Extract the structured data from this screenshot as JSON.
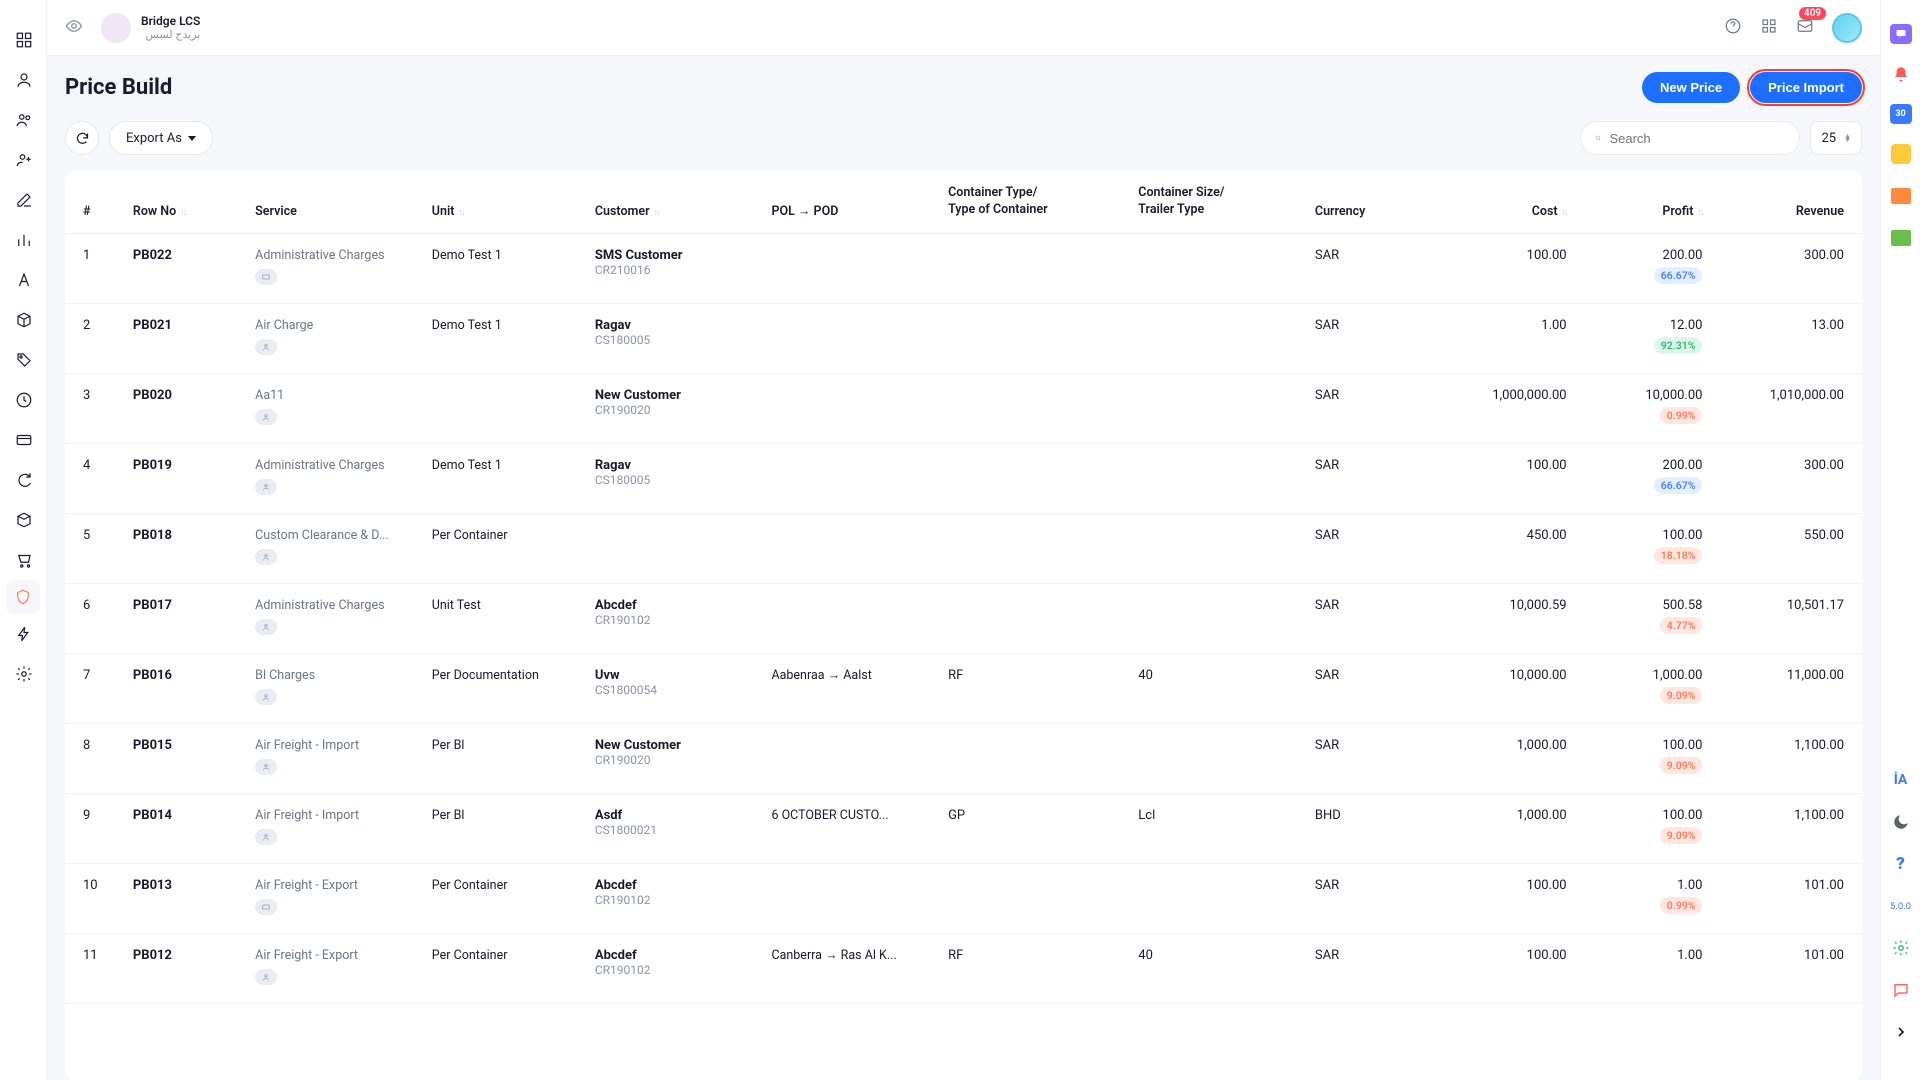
{
  "brand": {
    "name": "Bridge LCS",
    "subtitle": "بريدج لسس"
  },
  "notification_count": "409",
  "page_title": "Price Build",
  "actions": {
    "new_price": "New Price",
    "price_import": "Price Import"
  },
  "toolbar": {
    "export": "Export As",
    "search_placeholder": "Search",
    "page_size": "25"
  },
  "columns": {
    "idx": "#",
    "row_no": "Row No",
    "service": "Service",
    "unit": "Unit",
    "customer": "Customer",
    "pol_pod": "POL → POD",
    "container_type_l1": "Container Type/",
    "container_type_l2": "Type of Container",
    "container_size_l1": "Container Size/",
    "container_size_l2": "Trailer Type",
    "currency": "Currency",
    "cost": "Cost",
    "profit": "Profit",
    "revenue": "Revenue"
  },
  "rail": {
    "cal": "30",
    "lang": "İA",
    "question": "?",
    "version": "5.0.0"
  },
  "rows": [
    {
      "i": "1",
      "row": "PB022",
      "svc": "Administrative Charges",
      "ic": "m",
      "unit": "Demo Test 1",
      "cust": "SMS Customer",
      "code": "CR210016",
      "route": "",
      "ctype": "",
      "csize": "",
      "cur": "SAR",
      "cost": "100.00",
      "profit": "200.00",
      "pct": "66.67%",
      "pcls": "blue",
      "rev": "300.00"
    },
    {
      "i": "2",
      "row": "PB021",
      "svc": "Air Charge",
      "ic": "u",
      "unit": "Demo Test 1",
      "cust": "Ragav",
      "code": "CS180005",
      "route": "",
      "ctype": "",
      "csize": "",
      "cur": "SAR",
      "cost": "1.00",
      "profit": "12.00",
      "pct": "92.31%",
      "pcls": "green",
      "rev": "13.00"
    },
    {
      "i": "3",
      "row": "PB020",
      "svc": "Aa11",
      "ic": "u",
      "unit": "",
      "cust": "New Customer",
      "code": "CR190020",
      "route": "",
      "ctype": "",
      "csize": "",
      "cur": "SAR",
      "cost": "1,000,000.00",
      "profit": "10,000.00",
      "pct": "0.99%",
      "pcls": "red",
      "rev": "1,010,000.00"
    },
    {
      "i": "4",
      "row": "PB019",
      "svc": "Administrative Charges",
      "ic": "u",
      "unit": "Demo Test 1",
      "cust": "Ragav",
      "code": "CS180005",
      "route": "",
      "ctype": "",
      "csize": "",
      "cur": "SAR",
      "cost": "100.00",
      "profit": "200.00",
      "pct": "66.67%",
      "pcls": "blue",
      "rev": "300.00"
    },
    {
      "i": "5",
      "row": "PB018",
      "svc": "Custom Clearance & D...",
      "ic": "u",
      "unit": "Per Container",
      "cust": "",
      "code": "",
      "route": "",
      "ctype": "",
      "csize": "",
      "cur": "SAR",
      "cost": "450.00",
      "profit": "100.00",
      "pct": "18.18%",
      "pcls": "red",
      "rev": "550.00"
    },
    {
      "i": "6",
      "row": "PB017",
      "svc": "Administrative Charges",
      "ic": "u",
      "unit": "Unit Test",
      "cust": "Abcdef",
      "code": "CR190102",
      "route": "",
      "ctype": "",
      "csize": "",
      "cur": "SAR",
      "cost": "10,000.59",
      "profit": "500.58",
      "pct": "4.77%",
      "pcls": "red",
      "rev": "10,501.17"
    },
    {
      "i": "7",
      "row": "PB016",
      "svc": "Bl Charges",
      "ic": "u",
      "unit": "Per Documentation",
      "cust": "Uvw",
      "code": "CS1800054",
      "route": "Aabenraa → Aalst",
      "ctype": "RF",
      "csize": "40",
      "cur": "SAR",
      "cost": "10,000.00",
      "profit": "1,000.00",
      "pct": "9.09%",
      "pcls": "red",
      "rev": "11,000.00"
    },
    {
      "i": "8",
      "row": "PB015",
      "svc": "Air Freight - Import",
      "ic": "u",
      "unit": "Per Bl",
      "cust": "New Customer",
      "code": "CR190020",
      "route": "",
      "ctype": "",
      "csize": "",
      "cur": "SAR",
      "cost": "1,000.00",
      "profit": "100.00",
      "pct": "9.09%",
      "pcls": "red",
      "rev": "1,100.00"
    },
    {
      "i": "9",
      "row": "PB014",
      "svc": "Air Freight - Import",
      "ic": "u",
      "unit": "Per Bl",
      "cust": "Asdf",
      "code": "CS1800021",
      "route": "6 OCTOBER CUSTO...",
      "ctype": "GP",
      "csize": "Lcl",
      "cur": "BHD",
      "cost": "1,000.00",
      "profit": "100.00",
      "pct": "9.09%",
      "pcls": "red",
      "rev": "1,100.00"
    },
    {
      "i": "10",
      "row": "PB013",
      "svc": "Air Freight - Export",
      "ic": "m",
      "unit": "Per Container",
      "cust": "Abcdef",
      "code": "CR190102",
      "route": "",
      "ctype": "",
      "csize": "",
      "cur": "SAR",
      "cost": "100.00",
      "profit": "1.00",
      "pct": "0.99%",
      "pcls": "red",
      "rev": "101.00"
    },
    {
      "i": "11",
      "row": "PB012",
      "svc": "Air Freight - Export",
      "ic": "u",
      "unit": "Per Container",
      "cust": "Abcdef",
      "code": "CR190102",
      "route": "Canberra → Ras Al K...",
      "ctype": "RF",
      "csize": "40",
      "cur": "SAR",
      "cost": "100.00",
      "profit": "1.00",
      "pct": "",
      "pcls": "",
      "rev": "101.00"
    }
  ]
}
